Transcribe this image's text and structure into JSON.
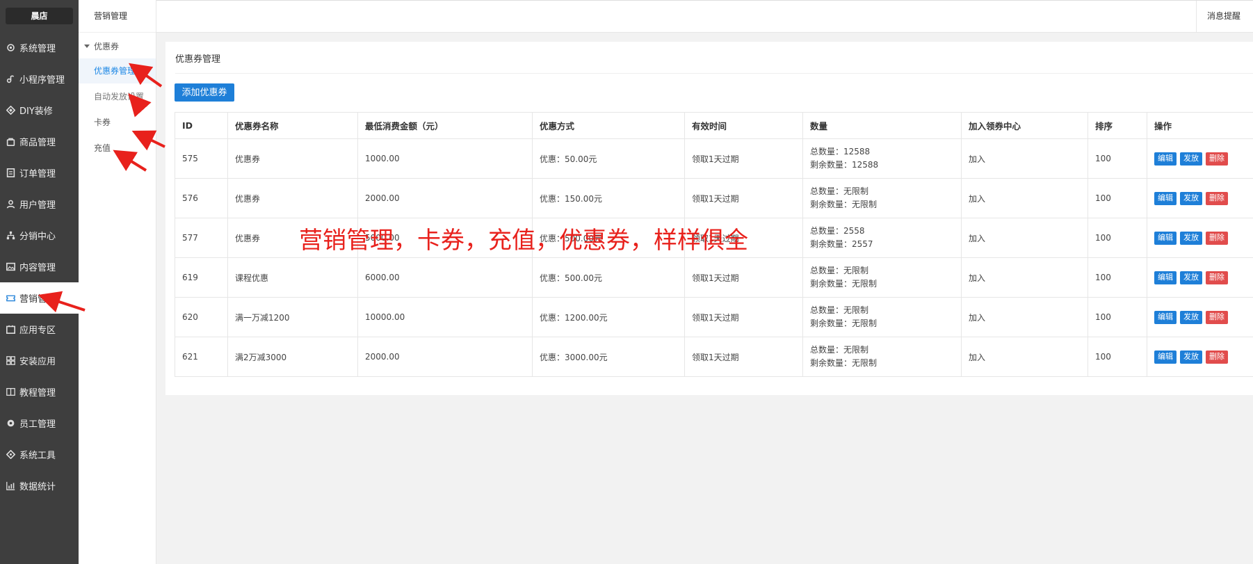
{
  "sidebar": {
    "brand": "晨店",
    "items": [
      {
        "label": "系统管理",
        "icon": "gear-icon"
      },
      {
        "label": "小程序管理",
        "icon": "link-icon"
      },
      {
        "label": "DIY装修",
        "icon": "diamond-icon"
      },
      {
        "label": "商品管理",
        "icon": "bag-icon"
      },
      {
        "label": "订单管理",
        "icon": "list-icon"
      },
      {
        "label": "用户管理",
        "icon": "user-icon"
      },
      {
        "label": "分销中心",
        "icon": "network-icon"
      },
      {
        "label": "内容管理",
        "icon": "picture-icon"
      },
      {
        "label": "营销管理",
        "icon": "ticket-icon"
      },
      {
        "label": "应用专区",
        "icon": "app-icon"
      },
      {
        "label": "安装应用",
        "icon": "grid-icon"
      },
      {
        "label": "教程管理",
        "icon": "book-icon"
      },
      {
        "label": "员工管理",
        "icon": "cog-icon"
      },
      {
        "label": "系统工具",
        "icon": "tool-icon"
      },
      {
        "label": "数据统计",
        "icon": "chart-icon"
      }
    ]
  },
  "subbar": {
    "title": "营销管理",
    "group": "优惠券",
    "items": [
      "优惠券管理",
      "自动发放设置",
      "卡券",
      "充值"
    ]
  },
  "topbar": {
    "message": "消息提醒"
  },
  "panel": {
    "title": "优惠券管理",
    "add_button": "添加优惠券",
    "columns": [
      "ID",
      "优惠券名称",
      "最低消费金额（元）",
      "优惠方式",
      "有效时间",
      "数量",
      "加入领券中心",
      "排序",
      "操作"
    ],
    "rows": [
      {
        "id": "575",
        "name": "优惠券",
        "min": "1000.00",
        "discount": "优惠：50.00元",
        "valid": "领取1天过期",
        "total": "总数量：12588",
        "remain": "剩余数量：12588",
        "center": "加入",
        "sort": "100"
      },
      {
        "id": "576",
        "name": "优惠券",
        "min": "2000.00",
        "discount": "优惠：150.00元",
        "valid": "领取1天过期",
        "total": "总数量：无限制",
        "remain": "剩余数量：无限制",
        "center": "加入",
        "sort": "100"
      },
      {
        "id": "577",
        "name": "优惠券",
        "min": "5000.00",
        "discount": "优惠：500.00元",
        "valid": "领取1天过期",
        "total": "总数量：2558",
        "remain": "剩余数量：2557",
        "center": "加入",
        "sort": "100"
      },
      {
        "id": "619",
        "name": "课程优惠",
        "min": "6000.00",
        "discount": "优惠：500.00元",
        "valid": "领取1天过期",
        "total": "总数量：无限制",
        "remain": "剩余数量：无限制",
        "center": "加入",
        "sort": "100"
      },
      {
        "id": "620",
        "name": "满一万减1200",
        "min": "10000.00",
        "discount": "优惠：1200.00元",
        "valid": "领取1天过期",
        "total": "总数量：无限制",
        "remain": "剩余数量：无限制",
        "center": "加入",
        "sort": "100"
      },
      {
        "id": "621",
        "name": "满2万减3000",
        "min": "2000.00",
        "discount": "优惠：3000.00元",
        "valid": "领取1天过期",
        "total": "总数量：无限制",
        "remain": "剩余数量：无限制",
        "center": "加入",
        "sort": "100"
      }
    ],
    "actions": {
      "edit": "编辑",
      "issue": "发放",
      "delete": "删除"
    }
  },
  "overlay": {
    "caption": "营销管理，卡券，充值，优惠券，样样俱全"
  },
  "colors": {
    "sidebar": "#3e3e3e",
    "accent": "#1e7fd8",
    "danger": "#e14c4c",
    "annotation": "#e8211c"
  }
}
